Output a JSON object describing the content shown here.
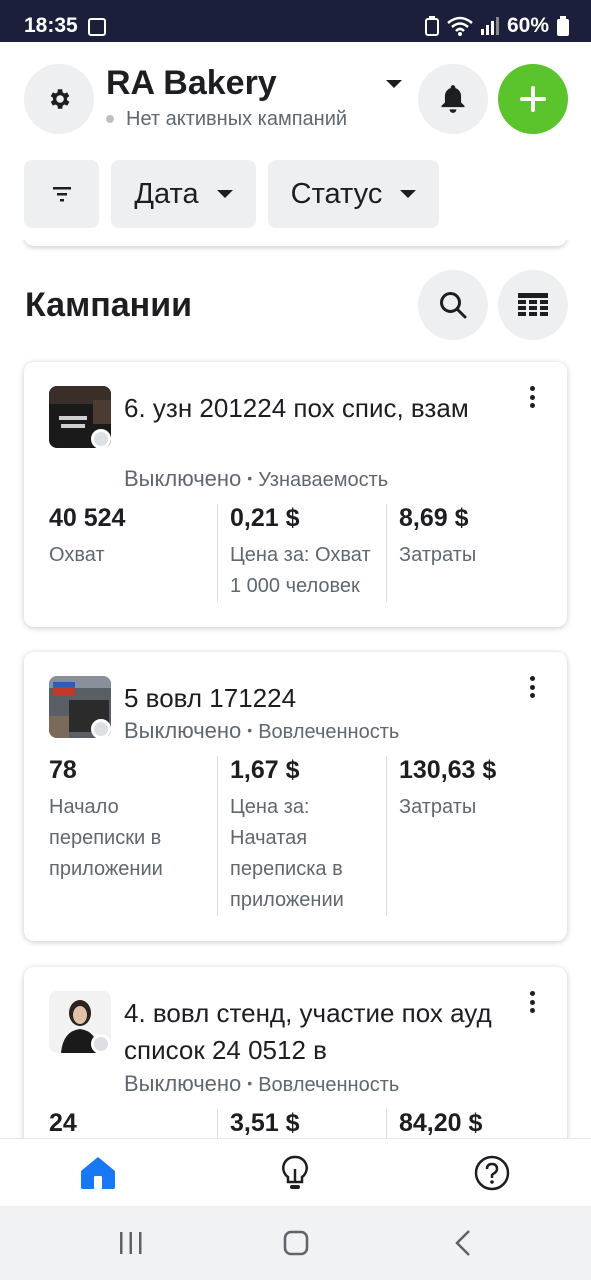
{
  "status_bar": {
    "time": "18:35",
    "battery": "60%"
  },
  "header": {
    "account_name": "RA Bakery",
    "account_status": "Нет активных кампаний"
  },
  "filters": {
    "date_label": "Дата",
    "status_label": "Статус"
  },
  "section": {
    "title": "Кампании"
  },
  "campaigns": [
    {
      "name": "6. узн 201224 пох спис, взам",
      "state": "Выключено",
      "objective": "Узнаваемость",
      "metrics": [
        {
          "value": "40 524",
          "label": "Охват"
        },
        {
          "value": "0,21 $",
          "label": "Цена за: Охват 1 000 человек"
        },
        {
          "value": "8,69 $",
          "label": "Затраты"
        }
      ]
    },
    {
      "name": "5 вовл 171224",
      "state": "Выключено",
      "objective": "Вовлеченность",
      "metrics": [
        {
          "value": "78",
          "label": "Начало переписки в приложении"
        },
        {
          "value": "1,67 $",
          "label": "Цена за: Начатая переписка в приложении"
        },
        {
          "value": "130,63 $",
          "label": "Затраты"
        }
      ]
    },
    {
      "name": "4. вовл стенд, участие пох ауд список 24 0512 в",
      "state": "Выключено",
      "objective": "Вовлеченность",
      "metrics": [
        {
          "value": "24",
          "label": ""
        },
        {
          "value": "3,51 $",
          "label": ""
        },
        {
          "value": "84,20 $",
          "label": ""
        }
      ]
    }
  ],
  "colors": {
    "accent_green": "#5bc42c",
    "accent_blue": "#1877f2",
    "text_primary": "#1c1e21",
    "text_secondary": "#606770"
  },
  "icons": [
    "settings-icon",
    "bell-icon",
    "plus-icon",
    "filter-icon",
    "search-icon",
    "table-icon",
    "home-icon",
    "lightbulb-icon",
    "help-icon"
  ]
}
